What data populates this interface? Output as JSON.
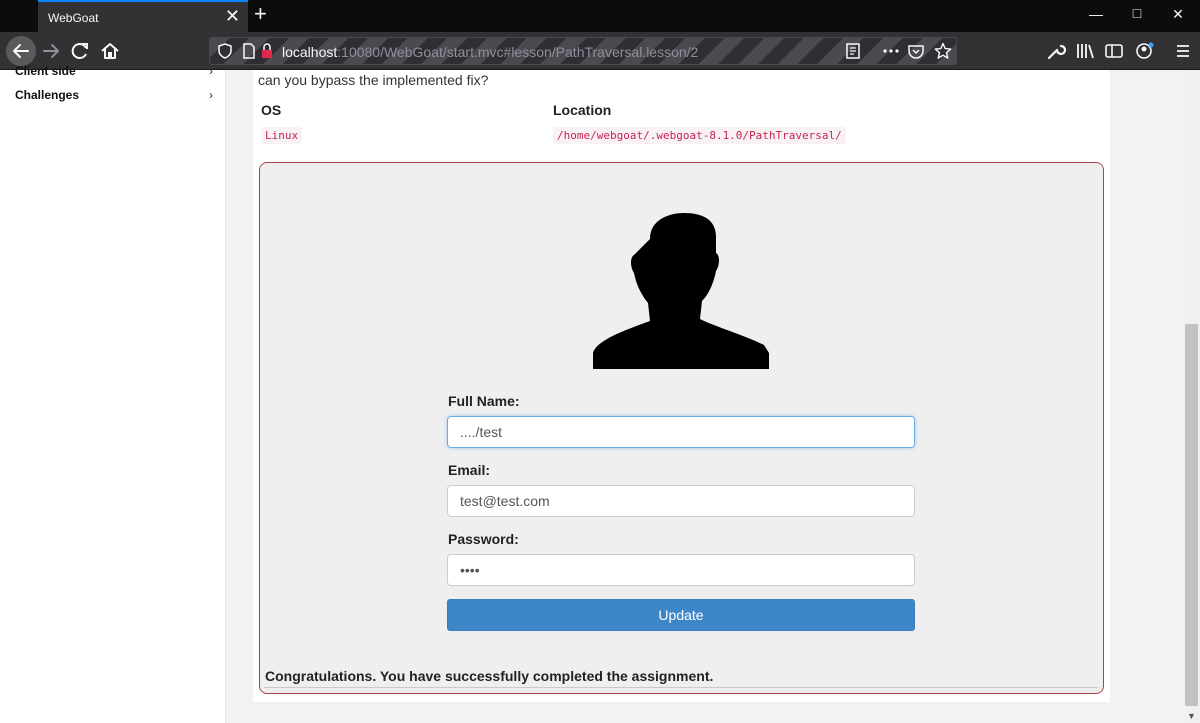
{
  "browser": {
    "tab_title": "WebGoat",
    "tab_close": "✕",
    "new_tab": "+",
    "url_host": "localhost",
    "url_path": ":10080/WebGoat/start.mvc#lesson/PathTraversal.lesson/2"
  },
  "sidebar": {
    "items": [
      {
        "label": "Client side"
      },
      {
        "label": "Challenges"
      }
    ],
    "chevron": "›"
  },
  "lesson": {
    "intro": "can you bypass the implemented fix?",
    "table": {
      "headers": [
        "OS",
        "Location"
      ],
      "rows": [
        [
          "Linux",
          "/home/webgoat/.webgoat-8.1.0/PathTraversal/"
        ]
      ]
    }
  },
  "form": {
    "full_name_label": "Full Name:",
    "full_name_value": "..../test",
    "email_label": "Email:",
    "email_value": "test@test.com",
    "password_label": "Password:",
    "password_value": "test",
    "update_label": "Update"
  },
  "feedback": "Congratulations. You have successfully completed the assignment.",
  "colors": {
    "accent": "#0a84ff",
    "button": "#3d87c9",
    "panel_border": "#a94442",
    "code_text": "#c7254e"
  }
}
